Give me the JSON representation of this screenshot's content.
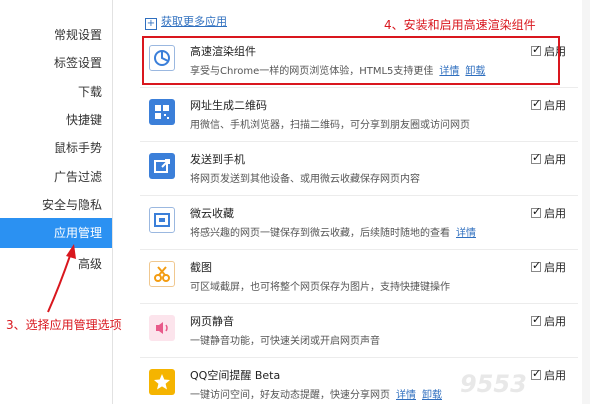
{
  "sidebar": {
    "items": [
      {
        "label": "常规设置"
      },
      {
        "label": "标签设置"
      },
      {
        "label": "下载"
      },
      {
        "label": "快捷键"
      },
      {
        "label": "鼠标手势"
      },
      {
        "label": "广告过滤"
      },
      {
        "label": "安全与隐私"
      },
      {
        "label": "应用管理"
      },
      {
        "label": "高级"
      }
    ]
  },
  "main": {
    "get_more": "获取更多应用",
    "detail_link": "详情",
    "uninstall_link": "卸载",
    "enable_label": "启用",
    "apps": [
      {
        "name": "高速渲染组件",
        "desc": "享受与Chrome一样的网页浏览体验，HTML5支持更佳",
        "icon": "chrome-circle-icon",
        "color": "#3b7fd9",
        "enabled": true
      },
      {
        "name": "网址生成二维码",
        "desc": "用微信、手机浏览器，扫描二维码，可分享到朋友圈或访问网页",
        "icon": "qrcode-icon",
        "color": "#3b7fd9",
        "enabled": true
      },
      {
        "name": "发送到手机",
        "desc": "将网页发送到其他设备、或用微云收藏保存网页内容",
        "icon": "share-phone-icon",
        "color": "#3b7fd9",
        "enabled": true
      },
      {
        "name": "微云收藏",
        "desc": "将感兴趣的网页一键保存到微云收藏，后续随时随地的查看",
        "icon": "weiyun-icon",
        "color": "#3b7fd9",
        "enabled": true
      },
      {
        "name": "截图",
        "desc": "可区域截屏，也可将整个网页保存为图片，支持快捷键操作",
        "icon": "scissors-icon",
        "color": "#f39c12",
        "enabled": true
      },
      {
        "name": "网页静音",
        "desc": "一键静音功能，可快速关闭或开启网页声音",
        "icon": "mute-icon",
        "color": "#e85a8a",
        "enabled": true
      },
      {
        "name": "QQ空间提醒 Beta",
        "desc": "一键访问空间，好友动态提醒，快速分享网页",
        "icon": "star-icon",
        "color": "#f5b400",
        "enabled": true
      }
    ]
  },
  "annotations": {
    "top": "4、安装和启用高速渲染组件",
    "bottom": "3、选择应用管理选项"
  },
  "watermark": "9553"
}
